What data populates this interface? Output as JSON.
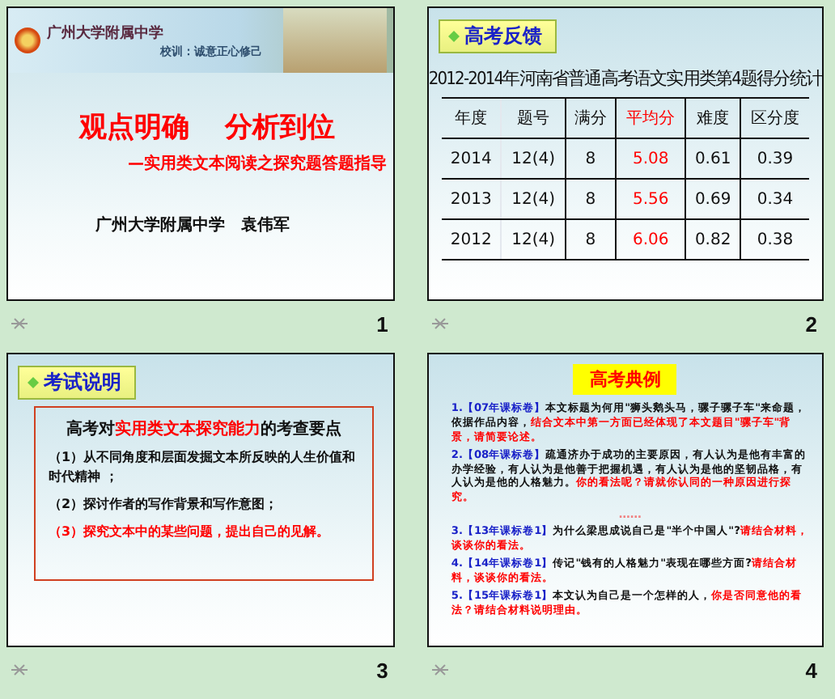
{
  "slides": [
    {
      "number": "1",
      "kind": "title",
      "banner": {
        "school": "广州大学附属中学",
        "motto": "校训：诚意正心修己"
      },
      "title_parts": [
        "观点明确",
        "分析到位"
      ],
      "subtitle": "—实用类文本阅读之探究题答题指导",
      "author": "广州大学附属中学　袁伟军"
    },
    {
      "number": "2",
      "kind": "table",
      "heading": "高考反馈",
      "table": {
        "title": "2012-2014年河南省普通高考语文实用类第4题得分统计",
        "columns": [
          {
            "label": "年度",
            "highlight": false
          },
          {
            "label": "题号",
            "highlight": false
          },
          {
            "label": "满分",
            "highlight": false
          },
          {
            "label": "平均分",
            "highlight": true
          },
          {
            "label": "难度",
            "highlight": false
          },
          {
            "label": "区分度",
            "highlight": false
          }
        ],
        "rows": [
          [
            "2014",
            "12(4)",
            "8",
            "5.08",
            "0.61",
            "0.39"
          ],
          [
            "2013",
            "12(4)",
            "8",
            "5.56",
            "0.69",
            "0.34"
          ],
          [
            "2012",
            "12(4)",
            "8",
            "6.06",
            "0.82",
            "0.38"
          ]
        ]
      }
    },
    {
      "number": "3",
      "kind": "bullets",
      "heading": "考试说明",
      "intro": [
        {
          "text": "高考对",
          "highlight": false
        },
        {
          "text": "实用类文本探究能力",
          "highlight": true
        },
        {
          "text": "的考查要点",
          "highlight": false
        }
      ],
      "items": [
        {
          "text": "（1）从不同角度和层面发掘文本所反映的人生价值和时代精神 ；",
          "highlight": false
        },
        {
          "text": "（2）探讨作者的写作背景和写作意图；",
          "highlight": false
        },
        {
          "text": "（3）探究文本中的某些问题，提出自己的见解。",
          "highlight": true
        }
      ]
    },
    {
      "number": "4",
      "kind": "examples",
      "heading": "高考典例",
      "items": [
        {
          "kind": "item",
          "source": "1.【07年课标卷】",
          "body": "本文标题为何用\"狮头鹅头马，骡子骡子车\"来命题，依据作品内容，",
          "question": "结合文本中第一方面已经体现了本文题目\"骡子车\"背景，请简要论述。"
        },
        {
          "kind": "item",
          "source": "2.【08年课标卷】",
          "body": "疏通济办于成功的主要原因，有人认为是他有丰富的办学经验，有人认为是他善于把握机遇，有人认为是他的坚韧品格，有人认为是他的人格魅力。",
          "question": "你的看法呢？请就你认同的一种原因进行探究。"
        },
        {
          "kind": "gap",
          "body": "……"
        },
        {
          "kind": "item",
          "source": "3.【13年课标卷1】",
          "body": "为什么梁思成说自己是\"半个中国人\"?",
          "question": "请结合材料，谈谈你的看法。"
        },
        {
          "kind": "item",
          "source": "4.【14年课标卷1】",
          "body": "传记\"钱有的人格魅力\"表现在哪些方面?",
          "question": "请结合材料，谈谈你的看法。"
        },
        {
          "kind": "item",
          "source": "5.【15年课标卷1】",
          "body": "本文认为自己是一个怎样的人，",
          "question": "你是否同意他的看法？请结合材料说明理由。"
        }
      ]
    }
  ]
}
